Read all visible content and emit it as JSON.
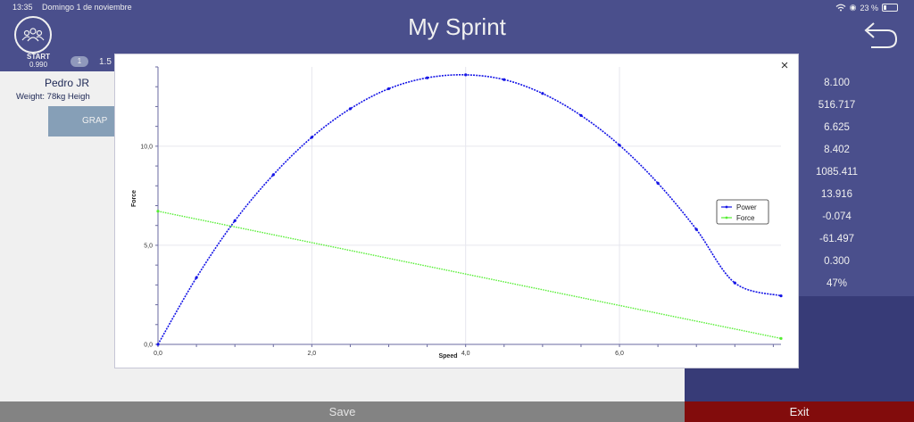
{
  "status_bar": {
    "time": "13:35",
    "date": "Domingo 1 de noviembre",
    "battery": "23 %",
    "battery_fraction": 0.23
  },
  "header": {
    "title": "My Sprint"
  },
  "icons": {
    "group": "group-icon",
    "back": "undo-arrow-icon",
    "close": "close-icon",
    "wifi": "wifi-icon",
    "battery": "battery-icon"
  },
  "start": {
    "label": "START",
    "value": "0.990"
  },
  "lap": {
    "badge": "1",
    "value": "1.5"
  },
  "athlete": {
    "name": "Pedro JR",
    "meta": "Weight: 78kg  Heigh"
  },
  "graph_button": {
    "label": "GRAP"
  },
  "metrics": [
    "8.100",
    "516.717",
    "6.625",
    "8.402",
    "1085.411",
    "13.916",
    "-0.074",
    "-61.497",
    "0.300",
    "47%"
  ],
  "footer": {
    "save": "Save",
    "exit": "Exit"
  },
  "modal": {
    "close_glyph": "×"
  },
  "colors": {
    "header": "#4f5495",
    "panel_dark": "#3b3f7f",
    "exit": "#8b0d0d",
    "save": "#8c8c8c",
    "power": "#1414e6",
    "force": "#55ee33"
  },
  "chart_data": {
    "type": "line",
    "xlabel": "Speed",
    "ylabel": "Force",
    "xlim": [
      0,
      8.1
    ],
    "ylim": [
      0,
      14
    ],
    "x_ticks": [
      0,
      2,
      4,
      6
    ],
    "x_tick_labels": [
      "0,0",
      "2,0",
      "4,0",
      "6,0"
    ],
    "y_ticks": [
      0,
      5,
      10
    ],
    "y_tick_labels": [
      "0,0",
      "5,0",
      "10,0"
    ],
    "grid": true,
    "legend_position": "right",
    "series": [
      {
        "name": "Power",
        "color": "#1414e6",
        "x": [
          0,
          0.5,
          1,
          1.5,
          2,
          2.5,
          3,
          3.5,
          4,
          4.5,
          5,
          5.5,
          6,
          6.5,
          7,
          7.5,
          8.1
        ],
        "y": [
          0,
          3.37,
          6.24,
          8.56,
          10.45,
          11.89,
          12.9,
          13.45,
          13.6,
          13.36,
          12.66,
          11.55,
          10.05,
          8.13,
          5.8,
          3.1,
          2.45
        ]
      },
      {
        "name": "Force",
        "color": "#55ee33",
        "x": [
          0,
          8.1
        ],
        "y": [
          6.72,
          0.3
        ]
      }
    ]
  }
}
